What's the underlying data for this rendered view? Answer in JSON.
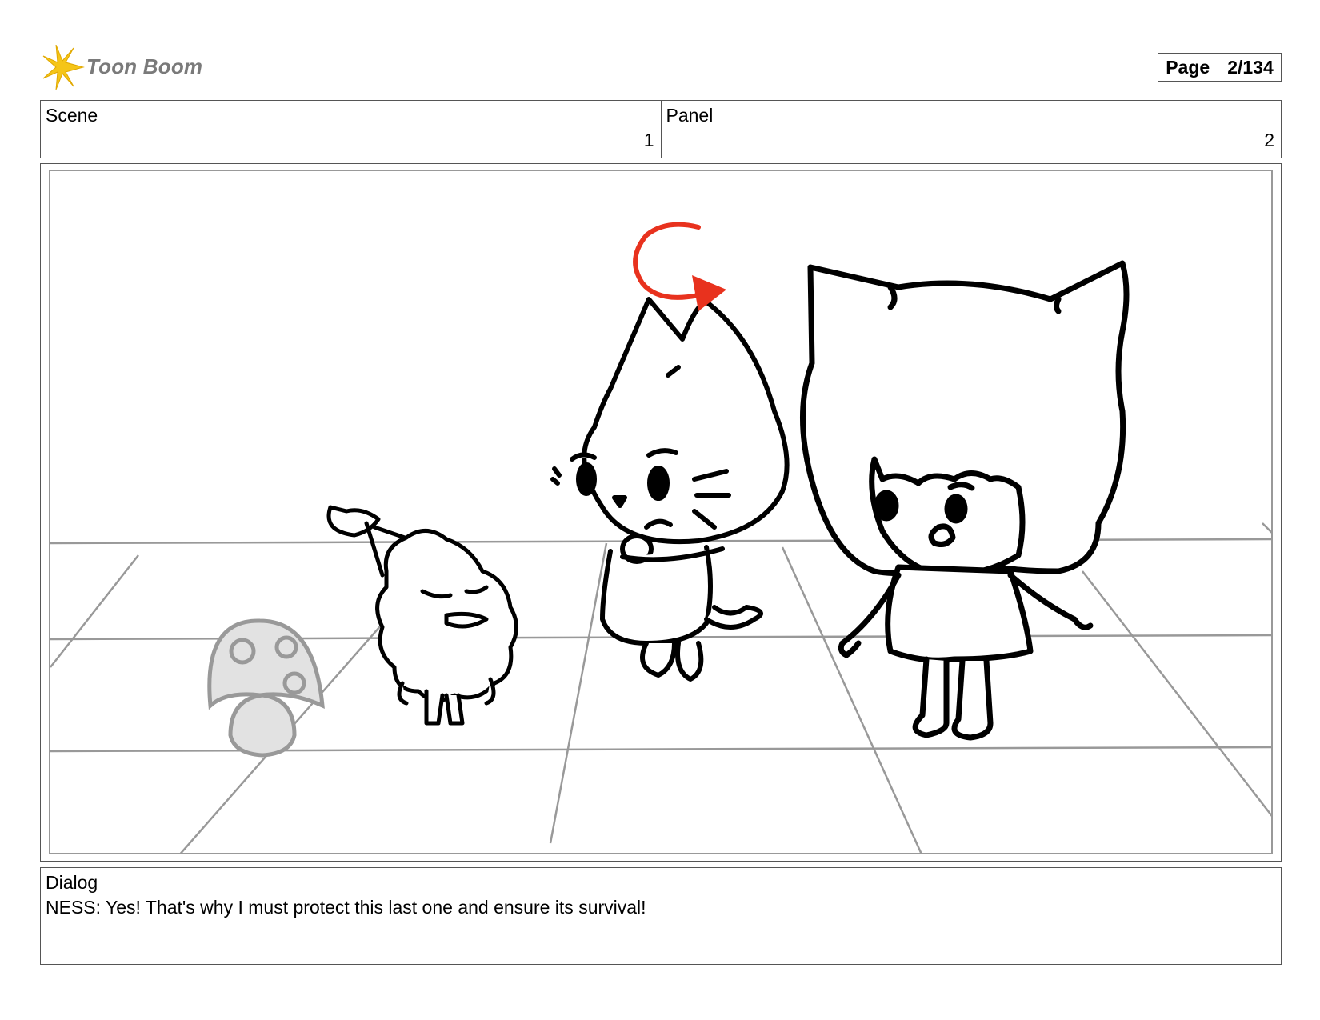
{
  "header": {
    "brand": "Toon Boom",
    "page_label": "Page",
    "page_value": "2/134"
  },
  "info": {
    "scene_label": "Scene",
    "scene_value": "1",
    "panel_label": "Panel",
    "panel_value": "2"
  },
  "dialog": {
    "label": "Dialog",
    "text": "NESS: Yes! That's why I must protect this last one and ensure its survival!"
  },
  "colors": {
    "accent_arrow": "#e8321e",
    "logo_yellow": "#f5c518",
    "line_gray": "#999999"
  },
  "icons": {
    "logo": "starburst-logo-icon"
  }
}
